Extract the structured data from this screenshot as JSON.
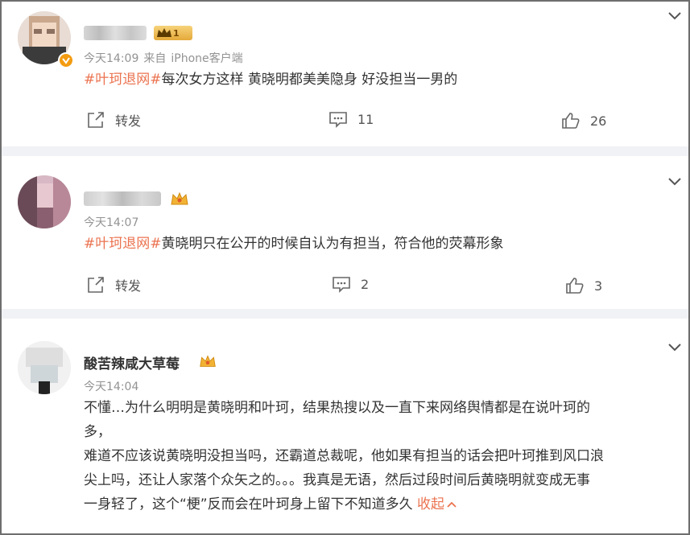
{
  "posts": [
    {
      "time": "今天14:09",
      "source_prefix": "来自",
      "source_device": "iPhone客户端",
      "hashtag": "#叶珂退网#",
      "text": "每次女方这样 黄晓明都美美隐身 好没担当一男的",
      "repost_label": "转发",
      "comment_count": "11",
      "like_count": "26",
      "vip_level": "1"
    },
    {
      "time": "今天14:07",
      "hashtag": "#叶珂退网#",
      "text": "黄晓明只在公开的时候自认为有担当，符合他的荧幕形象",
      "repost_label": "转发",
      "comment_count": "2",
      "like_count": "3"
    },
    {
      "username": "酸苦辣咸大草莓",
      "time": "今天14:04",
      "text_line1": "不懂…为什么明明是黄晓明和叶珂，结果热搜以及一直下来网络舆情都是在说叶珂的",
      "text_line2": "多，",
      "text_line3": "难道不应该说黄晓明没担当吗，还霸道总裁呢，他如果有担当的话会把叶珂推到风口浪",
      "text_line4": "尖上吗，还让人家落个众矢之的。。。我真是无语，然后过段时间后黄晓明就变成无事",
      "text_line5": "一身轻了，这个“梗”反而会在叶珂身上留下不知道多久",
      "collapse_label": "收起"
    }
  ],
  "colors": {
    "accent": "#eb7350",
    "meta": "#939393",
    "separator": "#f1f2f5"
  },
  "icons": [
    "repost-icon",
    "comment-icon",
    "like-icon",
    "chevron-down-icon",
    "verified-badge-icon",
    "crown-icon",
    "vip-badge-icon"
  ]
}
